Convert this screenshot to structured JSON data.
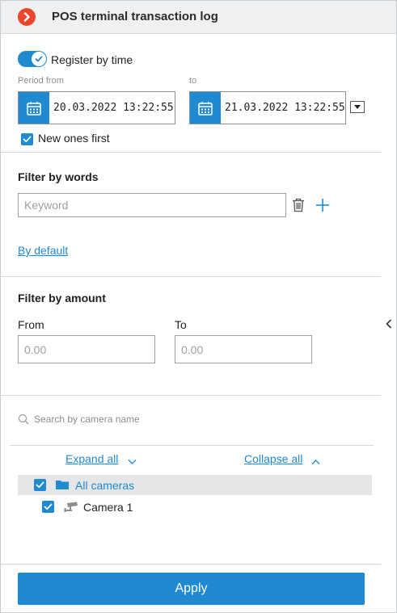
{
  "header": {
    "title": "POS terminal transaction log",
    "close_icon": "chevron-right-icon",
    "accent_color": "#e8472b"
  },
  "time_filter": {
    "toggle_label": "Register by time",
    "toggle_on": true,
    "from_label": "Period from",
    "to_label": "to",
    "from_value": "20.03.2022  13:22:55",
    "to_value": "21.03.2022  13:22:55",
    "new_first_label": "New ones first",
    "new_first_checked": true
  },
  "words_filter": {
    "title": "Filter by words",
    "keyword_placeholder": "Keyword",
    "default_link": "By default"
  },
  "amount_filter": {
    "title": "Filter by amount",
    "from_label": "From",
    "to_label": "To",
    "from_placeholder": "0.00",
    "to_placeholder": "0.00"
  },
  "cameras": {
    "search_placeholder": "Search by camera name",
    "expand_all": "Expand all",
    "collapse_all": "Collapse all",
    "items": [
      {
        "label": "All cameras",
        "checked": true,
        "icon": "folder-icon"
      },
      {
        "label": "Camera 1",
        "checked": true,
        "icon": "camera-icon"
      }
    ]
  },
  "footer": {
    "apply_label": "Apply"
  },
  "colors": {
    "primary": "#1f8ad0",
    "selected_row": "#e4e6e8"
  }
}
